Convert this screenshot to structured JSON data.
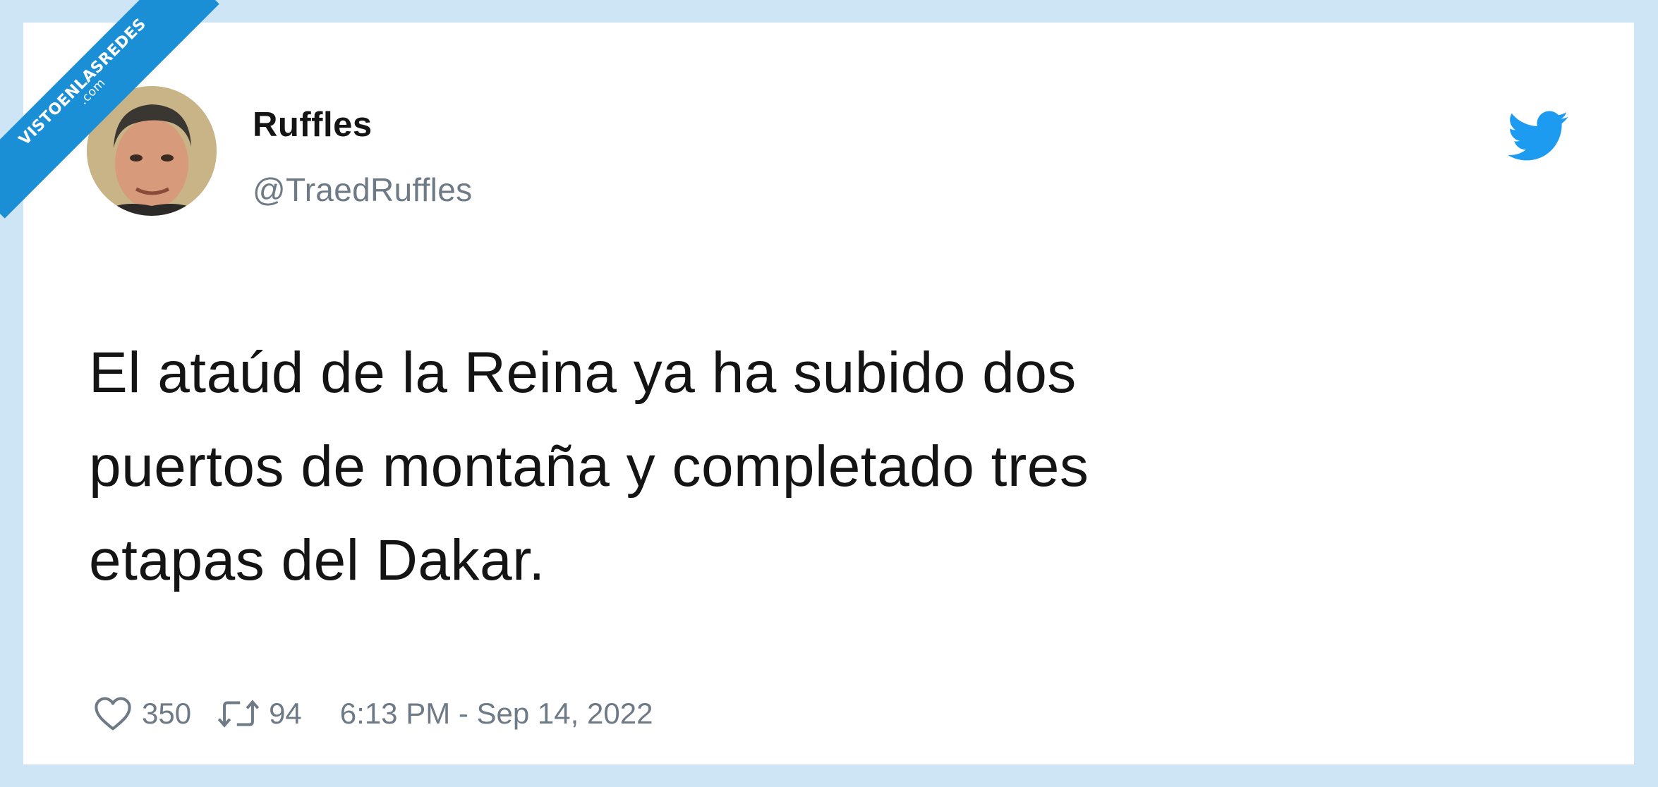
{
  "watermark": {
    "line1": "VISTOENLASREDES",
    "line2": ".com"
  },
  "tweet": {
    "display_name": "Ruffles",
    "handle": "@TraedRuffles",
    "text": "El ataúd de la Reina ya ha subido dos\npuertos de montaña y completado tres\netapas del Dakar.",
    "likes": "350",
    "retweets": "94",
    "timestamp": "6:13 PM - Sep 14, 2022"
  },
  "icons": {
    "brand": "twitter-bird-icon",
    "like": "heart-icon",
    "retweet": "retweet-icon"
  },
  "colors": {
    "background": "#cde5f5",
    "card": "#ffffff",
    "twitter_blue": "#1d9bf0",
    "muted_text": "#6e7a85",
    "primary_text": "#141414",
    "watermark": "#1b8fd6"
  }
}
